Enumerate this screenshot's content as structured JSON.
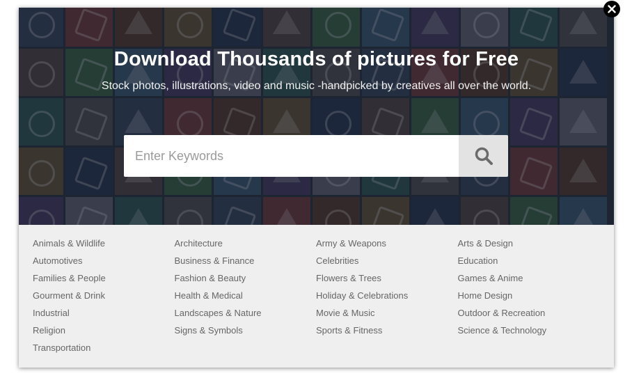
{
  "hero": {
    "title": "Download Thousands of pictures for Free",
    "subtitle": "Stock photos, illustrations, video and music -handpicked by creatives all over the world."
  },
  "search": {
    "placeholder": "Enter Keywords",
    "button_icon": "search-icon"
  },
  "close_icon": "close-icon",
  "categories": [
    "Animals & Wildlife",
    "Architecture",
    "Army & Weapons",
    "Arts & Design",
    "Automotives",
    "Business & Finance",
    "Celebrities",
    "Education",
    "Families & People",
    "Fashion & Beauty",
    "Flowers & Trees",
    "Games & Anime",
    "Gourment & Drink",
    "Health & Medical",
    "Holiday & Celebrations",
    "Home Design",
    "Industrial",
    "Landscapes & Nature",
    "Movie & Music",
    "Outdoor & Recreation",
    "Religion",
    "Signs & Symbols",
    "Sports & Fitness",
    "Science & Technology",
    "Transportation"
  ],
  "colors": {
    "overlay": "#121826",
    "panel_background": "#efefef",
    "category_text": "#666666",
    "search_button": "#e3e3e3"
  }
}
